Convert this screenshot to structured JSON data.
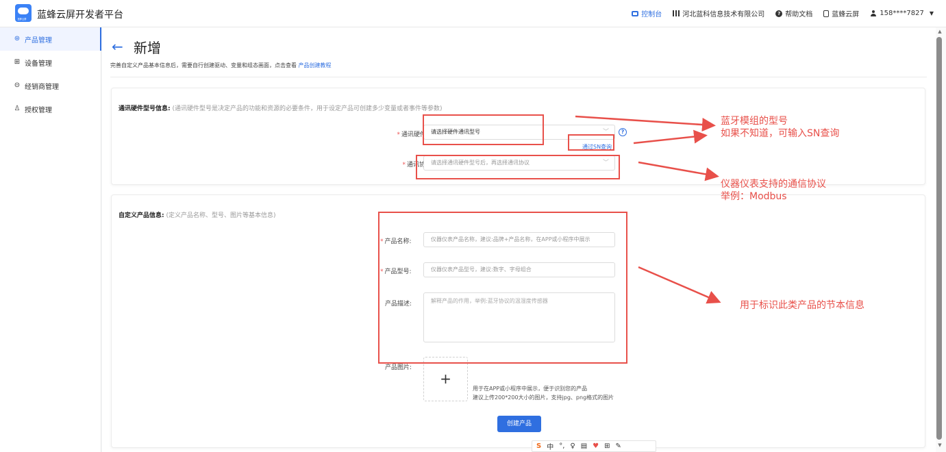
{
  "header": {
    "app_title": "蓝蜂云屏开发者平台",
    "logo_sub": "蓝蜂云屏",
    "links": {
      "console": "控制台",
      "company": "河北蓝科信息技术有限公司",
      "help": "帮助文档",
      "cloud_screen": "蓝蜂云屏",
      "user": "158****7827"
    }
  },
  "sidebar": {
    "items": [
      {
        "label": "产品管理",
        "icon": "⊛"
      },
      {
        "label": "设备管理",
        "icon": "⊞"
      },
      {
        "label": "经销商管理",
        "icon": "⊝"
      },
      {
        "label": "授权管理",
        "icon": "♙"
      }
    ]
  },
  "page": {
    "back_arrow": "←",
    "title": "新增",
    "subtitle": "完善自定义产品基本信息后，需要自行创建驱动、变量和组态画面，点击查看",
    "subtitle_link": "产品创建教程"
  },
  "hardware_section": {
    "title": "通讯硬件型号信息:",
    "desc": "(通讯硬件型号是决定产品的功能和资源的必要条件，用于设定产品可创建多少变量或者事件等参数)",
    "model_label": "通讯硬件型号:",
    "model_value": "请选择硬件通讯型号",
    "sn_link": "通过SN查询",
    "help": "?",
    "protocol_label": "通讯协议:",
    "protocol_placeholder": "请选择通讯硬件型号后，再选择通讯协议"
  },
  "product_section": {
    "title": "自定义产品信息:",
    "desc": "(定义产品名称、型号、图片等基本信息)",
    "name_label": "产品名称:",
    "name_placeholder": "仪器仪表产品名称，建议:品牌+产品名称，在APP或小程序中展示",
    "model_label": "产品型号:",
    "model_placeholder": "仪器仪表产品型号，建议:数字、字母组合",
    "desc_label": "产品描述:",
    "desc_placeholder": "解释产品的作用，举例:蓝牙协议的温湿度传感器",
    "image_label": "产品图片:",
    "upload_plus": "+",
    "upload_hint_1": "用于在APP或小程序中展示，便于识别您的产品",
    "upload_hint_2": "建议上传200*200大小的图片，支持jpg、png格式的图片",
    "create_button": "创建产品"
  },
  "annotations": {
    "bt_model_1": "蓝牙模组的型号",
    "bt_model_2": "如果不知道，可输入SN查询",
    "protocol_1": "仪器仪表支持的通信协议",
    "protocol_2": "举例：Modbus",
    "product_info": "用于标识此类产品的节本信息"
  },
  "ime": {
    "items": [
      "S",
      "中",
      "°,",
      "♀",
      "▤",
      "♥",
      "⊞",
      "✎"
    ]
  },
  "colors": {
    "accent": "#2f6fe0",
    "annotation": "#e8504a"
  }
}
